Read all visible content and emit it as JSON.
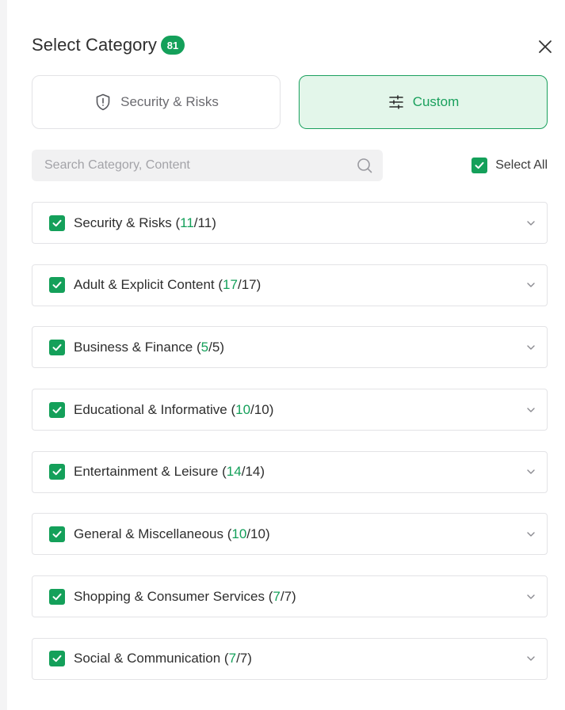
{
  "header": {
    "title": "Select Category",
    "badge": "81"
  },
  "tabs": [
    {
      "label": "Security & Risks",
      "icon": "shield-alert-icon",
      "active": false
    },
    {
      "label": "Custom",
      "icon": "sliders-icon",
      "active": true
    }
  ],
  "search": {
    "placeholder": "Search Category, Content",
    "value": ""
  },
  "select_all": {
    "label": "Select All",
    "checked": true
  },
  "categories": [
    {
      "name": "Security & Risks",
      "selected": "11",
      "total": "11",
      "checked": true
    },
    {
      "name": "Adult & Explicit Content",
      "selected": "17",
      "total": "17",
      "checked": true
    },
    {
      "name": "Business & Finance",
      "selected": "5",
      "total": "5",
      "checked": true
    },
    {
      "name": "Educational & Informative",
      "selected": "10",
      "total": "10",
      "checked": true
    },
    {
      "name": "Entertainment & Leisure",
      "selected": "14",
      "total": "14",
      "checked": true
    },
    {
      "name": "General & Miscellaneous",
      "selected": "10",
      "total": "10",
      "checked": true
    },
    {
      "name": "Shopping & Consumer Services",
      "selected": "7",
      "total": "7",
      "checked": true
    },
    {
      "name": "Social & Communication",
      "selected": "7",
      "total": "7",
      "checked": true
    }
  ],
  "colors": {
    "accent": "#14a05a",
    "accent_bg": "#e3f6ea",
    "border": "#e3e3e6"
  }
}
